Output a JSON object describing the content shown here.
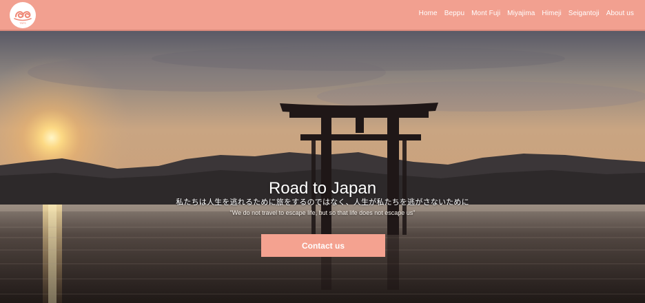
{
  "header": {
    "logo_icon": "spiral-wave-logo-icon",
    "logo_caption": "TRIPS",
    "nav": [
      {
        "label": "Home"
      },
      {
        "label": "Beppu"
      },
      {
        "label": "Mont Fuji"
      },
      {
        "label": "Miyajima"
      },
      {
        "label": "Himeji"
      },
      {
        "label": "Seigantoji"
      },
      {
        "label": "About us"
      }
    ]
  },
  "hero": {
    "background": "torii-gate-at-sunset-photo",
    "title": "Road to Japan",
    "subtitle_jp": "私たちは人生を逃れるために旅をするのではなく、人生が私たちを逃がさないために",
    "subtitle_en": "\"We do not travel to escape life, but so that life does not escape us\"",
    "cta_label": "Contact us"
  },
  "colors": {
    "accent": "#f2a090",
    "button": "#f4a290",
    "text": "#ffffff"
  }
}
